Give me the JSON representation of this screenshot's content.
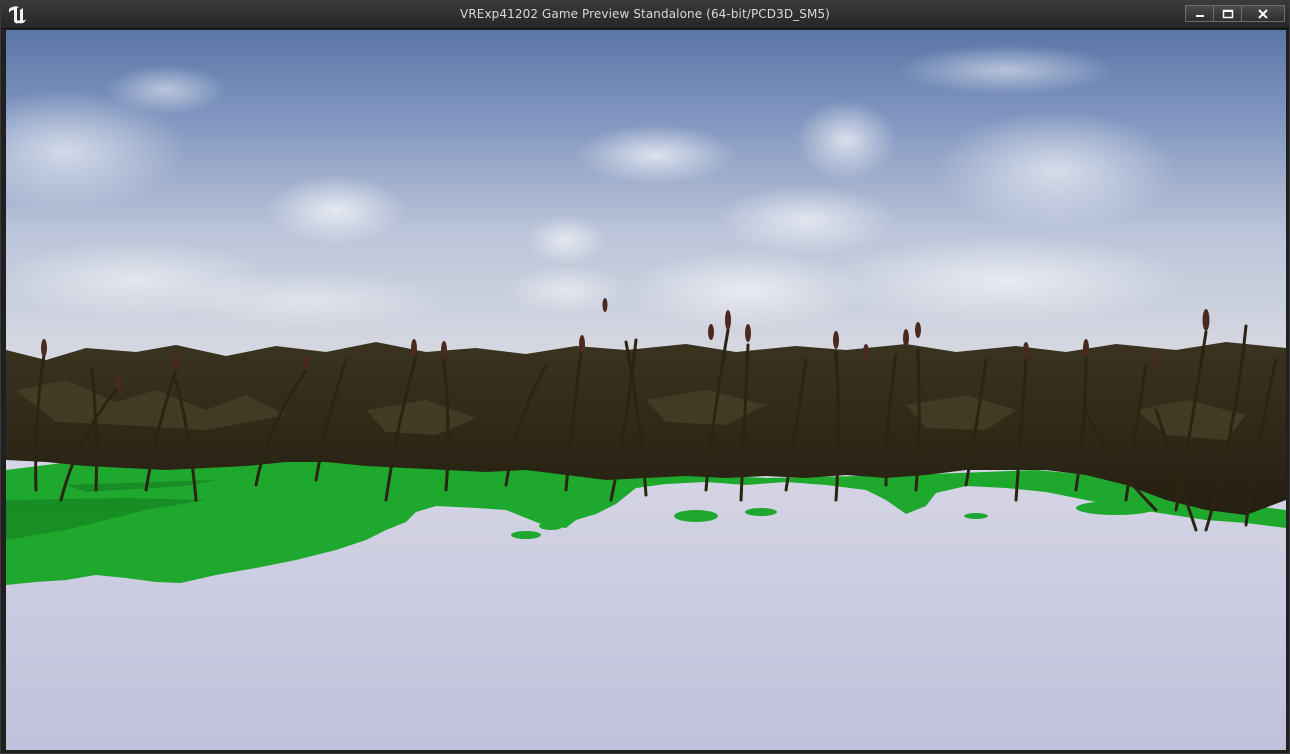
{
  "window": {
    "title": "VRExp41202 Game Preview Standalone (64-bit/PCD3D_SM5)",
    "controls": [
      "minimize",
      "maximize",
      "close"
    ]
  },
  "icons": {
    "app_logo": "unreal-engine-logo-icon",
    "minimize": "minimize-icon",
    "maximize": "maximize-icon",
    "close": "close-icon"
  },
  "scene": {
    "sky": "cloudy blue sky",
    "vegetation": "cattail reeds",
    "ground": "green grass patches over pale lavender ground",
    "colors": {
      "sky_top": "#5d79aa",
      "sky_horizon": "#d9dbe3",
      "reeds": "#2f2815",
      "grass": "#1fa82e",
      "ground": "#c3c4dc"
    }
  }
}
